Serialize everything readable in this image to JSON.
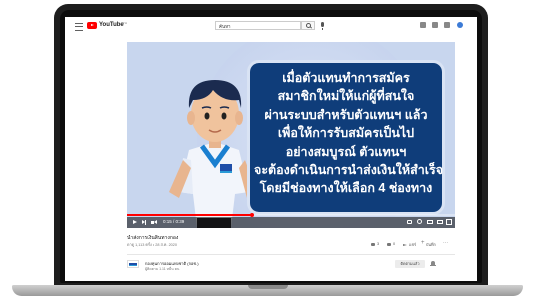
{
  "header": {
    "logo_text": "YouTube",
    "logo_country": "TH",
    "search_value": "ค้นหา"
  },
  "video": {
    "overlay_lines": [
      "เมื่อตัวแทนทำการสมัคร",
      "สมาชิกใหม่ให้แก่ผู้ที่สนใจ",
      "ผ่านระบบสำหรับตัวแทนฯ แล้ว",
      "เพื่อให้การรับสมัครเป็นไป",
      "อย่างสมบูรณ์ ตัวแทนฯ",
      "จะต้องดำเนินการนำส่งเงินให้สำเร็จ",
      "โดยมีช่องทางให้เลือก 4 ช่องทาง"
    ],
    "time": "0:15 / 0:39",
    "progress": 0.38,
    "colors": {
      "box": "#0f3d7a",
      "progress": "#ff0000"
    }
  },
  "info": {
    "title": "นำส่งการเงินสินทางกอง",
    "views": "ดาดู 1,113 ครั้ง • 28 ส.ค. 2020",
    "likes": "3",
    "dislikes": "0",
    "share_label": "แชร์",
    "save_label": "บันทึก"
  },
  "channel": {
    "name": "กองทุนการออมแห่งชาติ (กอช.)",
    "subs": "ผู้ติดตาม 1.11 หมื่น คน",
    "subscribe_label": "ติดตามแล้ว"
  }
}
